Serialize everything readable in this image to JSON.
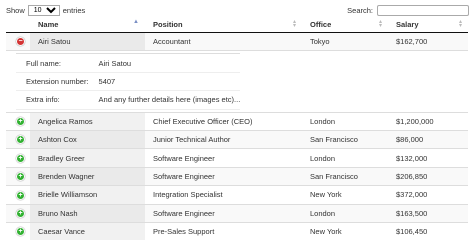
{
  "length_menu": {
    "show_label": "Show",
    "value": "10",
    "entries_label": "entries"
  },
  "search": {
    "label": "Search:",
    "value": ""
  },
  "columns": [
    "Name",
    "Position",
    "Office",
    "Salary"
  ],
  "expanded": {
    "name": "Airi Satou",
    "position": "Accountant",
    "office": "Tokyo",
    "salary": "$162,700",
    "details": [
      {
        "label": "Full name:",
        "value": "Airi Satou"
      },
      {
        "label": "Extension number:",
        "value": "5407"
      },
      {
        "label": "Extra info:",
        "value": "And any further details here (images etc)..."
      }
    ]
  },
  "rows": [
    {
      "name": "Angelica Ramos",
      "position": "Chief Executive Officer (CEO)",
      "office": "London",
      "salary": "$1,200,000"
    },
    {
      "name": "Ashton Cox",
      "position": "Junior Technical Author",
      "office": "San Francisco",
      "salary": "$86,000"
    },
    {
      "name": "Bradley Greer",
      "position": "Software Engineer",
      "office": "London",
      "salary": "$132,000"
    },
    {
      "name": "Brenden Wagner",
      "position": "Software Engineer",
      "office": "San Francisco",
      "salary": "$206,850"
    },
    {
      "name": "Brielle Williamson",
      "position": "Integration Specialist",
      "office": "New York",
      "salary": "$372,000"
    },
    {
      "name": "Bruno Nash",
      "position": "Software Engineer",
      "office": "London",
      "salary": "$163,500"
    },
    {
      "name": "Caesar Vance",
      "position": "Pre-Sales Support",
      "office": "New York",
      "salary": "$106,450"
    }
  ],
  "icons": {
    "open": "minus-circle-icon",
    "closed": "plus-circle-icon"
  },
  "colors": {
    "open": "#d33333",
    "closed": "#31b131"
  }
}
